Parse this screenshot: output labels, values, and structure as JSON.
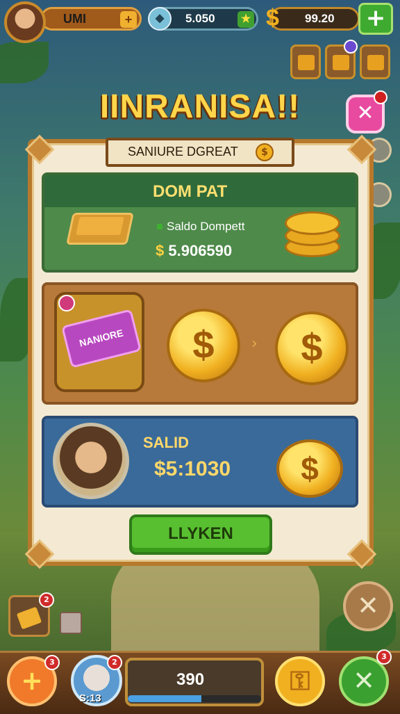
{
  "hud": {
    "player_name": "UMI",
    "gems": "5.050",
    "coins": "99.20",
    "coin_symbol": "$",
    "plus_symbol": "+",
    "star_symbol": "★"
  },
  "title": "IINRANISA!!",
  "ribbon": {
    "text": "SANIURE DGREAT",
    "coin_symbol": "$"
  },
  "wallet": {
    "header": "DOM PAT",
    "label": "Saldo Dompett",
    "currency": "$",
    "value": "5.906590"
  },
  "exchange": {
    "ticket_text": "NANIORE",
    "coin_symbol": "$",
    "arrow": "›"
  },
  "balance": {
    "label": "SALID",
    "value": "$5:1030",
    "coin_symbol": "$"
  },
  "action_button": "LLYKEN",
  "close_symbol": "✕",
  "bottom_bar": {
    "plus_symbol": "+",
    "avatar_label": "S:13",
    "counter": "390",
    "progress": 0.55,
    "badge_count": "3",
    "avatar_badge": "2",
    "x_symbol": "✕"
  },
  "badges": {
    "gold_item": "2",
    "bottom_left": "3",
    "bottom_right": "3"
  },
  "colors": {
    "title": "#ffd54a",
    "panel": "#f4ead3",
    "green_section": "#4e8a4a",
    "brown_section": "#b87a3a",
    "blue_section": "#3a6a9a",
    "action_button": "#58c030"
  },
  "icons": [
    "player-avatar",
    "gem-icon",
    "coin-icon",
    "gold-bar-icon",
    "ticket-icon",
    "coin-stack-icon",
    "close-icon",
    "character-portrait"
  ]
}
